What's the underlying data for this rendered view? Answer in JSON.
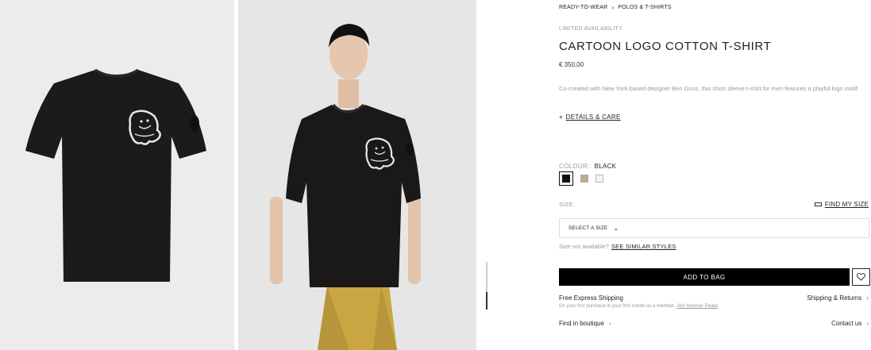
{
  "breadcrumb": [
    "READY-TO-WEAR",
    "POLOS & T-SHIRTS"
  ],
  "breadcrumb_sep": "›",
  "product": {
    "availability": "LIMITED AVAILABILITY",
    "title": "CARTOON LOGO COTTON T-SHIRT",
    "price": "€ 350,00",
    "description": "Co-created with New York-based designer Ben Gonz, this short sleeve t-shirt for men features a playful logo motif.",
    "details_prefix": "+",
    "details_link": "DETAILS & CARE"
  },
  "colour": {
    "label": "COLOUR:",
    "selected": "BLACK",
    "swatches": [
      {
        "name": "black",
        "color": "#111111",
        "selected": true
      },
      {
        "name": "beige",
        "color": "#b9ad8e",
        "selected": false
      },
      {
        "name": "white",
        "color": "#f4f4fa",
        "selected": false
      }
    ]
  },
  "size": {
    "label": "SIZE:",
    "find_link": "FIND MY SIZE",
    "select_placeholder": "SELECT A SIZE",
    "not_available_text": "Size not available?",
    "similar_link": "SEE SIMILAR STYLES"
  },
  "actions": {
    "add_to_bag": "ADD TO BAG"
  },
  "shipping": {
    "title": "Free Express Shipping",
    "subtitle": "On your first purchase in your first month as a member.",
    "subtitle_link": "Join Moncler Peaks",
    "returns": "Shipping & Returns"
  },
  "footer_links": {
    "boutique": "Find in boutique",
    "contact": "Contact us"
  },
  "chevron": "›",
  "images": [
    {
      "name": "product-flat-image",
      "graphic": "black t-shirt with cartoon logo"
    },
    {
      "name": "product-model-image",
      "graphic": "model wearing black t-shirt"
    }
  ]
}
